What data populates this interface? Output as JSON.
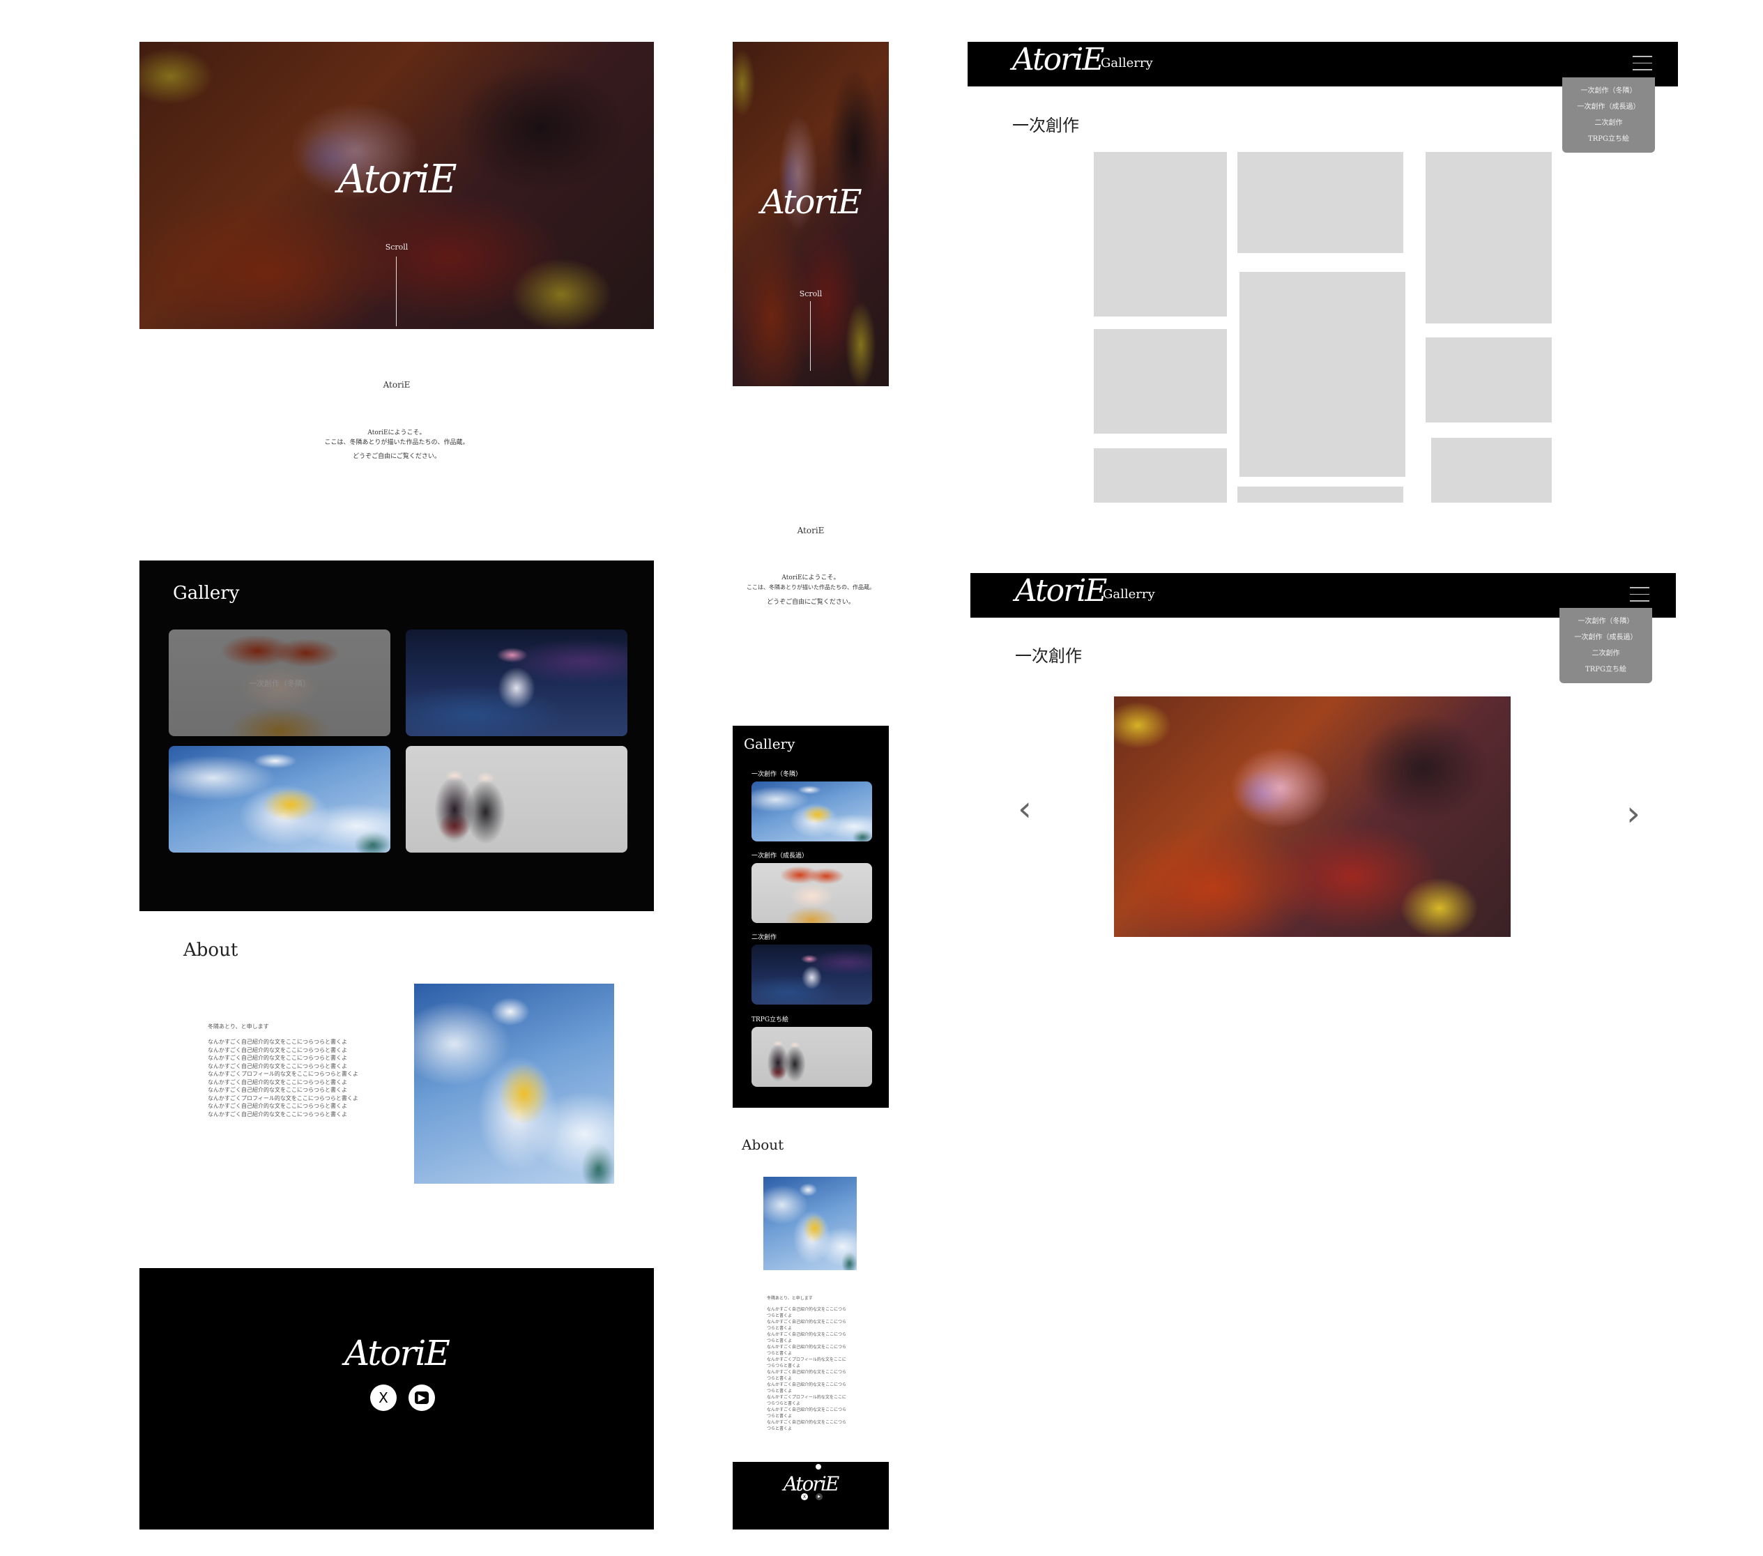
{
  "brand": {
    "logo_text": "AtoriE",
    "site_name": "AtoriE",
    "colors": {
      "dark": "#000000",
      "placeholder": "#d9d9d9",
      "dropdown": "#8a8a8a"
    }
  },
  "hero": {
    "scroll_label": "Scroll"
  },
  "intro": {
    "line1": "AtoriEにようこそ。",
    "line2": "ここは、冬隣あとりが描いた作品たちの、作品蔵。",
    "line3": "どうぞご自由にご覧ください。"
  },
  "gallery": {
    "heading": "Gallery",
    "desktop_hover_caption": "一次創作（冬隣）",
    "mobile_items": [
      {
        "label": "一次創作（冬隣）"
      },
      {
        "label": "一次創作（成長過）"
      },
      {
        "label": "二次創作"
      },
      {
        "label": "TRPG立ち絵"
      }
    ]
  },
  "about": {
    "heading": "About",
    "greeting": "冬隣あとり、と申します",
    "lines_desktop": [
      "なんかすごく自己紹介的な文をここにつらつらと書くよ",
      "なんかすごく自己紹介的な文をここにつらつらと書くよ",
      "なんかすごく自己紹介的な文をここにつらつらと書くよ",
      "なんかすごく自己紹介的な文をここにつらつらと書くよ",
      "なんかすごくプロフィール的な文をここにつらつらと書くよ",
      "なんかすごく自己紹介的な文をここにつらつらと書くよ",
      "なんかすごく自己紹介的な文をここにつらつらと書くよ",
      "なんかすごくプロフィール的な文をここにつらつらと書くよ",
      "なんかすごく自己紹介的な文をここにつらつらと書くよ",
      "なんかすごく自己紹介的な文をここにつらつらと書くよ"
    ],
    "lines_mobile": [
      "なんかすごく自己紹介的な文をここにつら",
      "つらと書くよ",
      "なんかすごく自己紹介的な文をここにつら",
      "つらと書くよ",
      "なんかすごく自己紹介的な文をここにつら",
      "つらと書くよ",
      "なんかすごく自己紹介的な文をここにつら",
      "つらと書くよ",
      "なんかすごくプロフィール的な文をここに",
      "つらつらと書くよ",
      "なんかすごく自己紹介的な文をここにつら",
      "つらと書くよ",
      "なんかすごく自己紹介的な文をここにつら",
      "つらと書くよ",
      "なんかすごくプロフィール的な文をここに",
      "つらつらと書くよ",
      "なんかすごく自己紹介的な文をここにつら",
      "つらと書くよ",
      "なんかすごく自己紹介的な文をここにつら",
      "つらと書くよ"
    ]
  },
  "footer": {
    "social": [
      {
        "icon": "x-icon",
        "glyph": "X"
      },
      {
        "icon": "youtube-icon",
        "glyph": "▶"
      }
    ]
  },
  "gallery_page": {
    "nav_title": "Gallerry",
    "section_title": "一次創作",
    "menu": [
      "一次創作（冬隣）",
      "一次創作（成長過）",
      "二次創作",
      "TRPG立ち絵"
    ],
    "prev_glyph": "‹",
    "next_glyph": "›"
  }
}
